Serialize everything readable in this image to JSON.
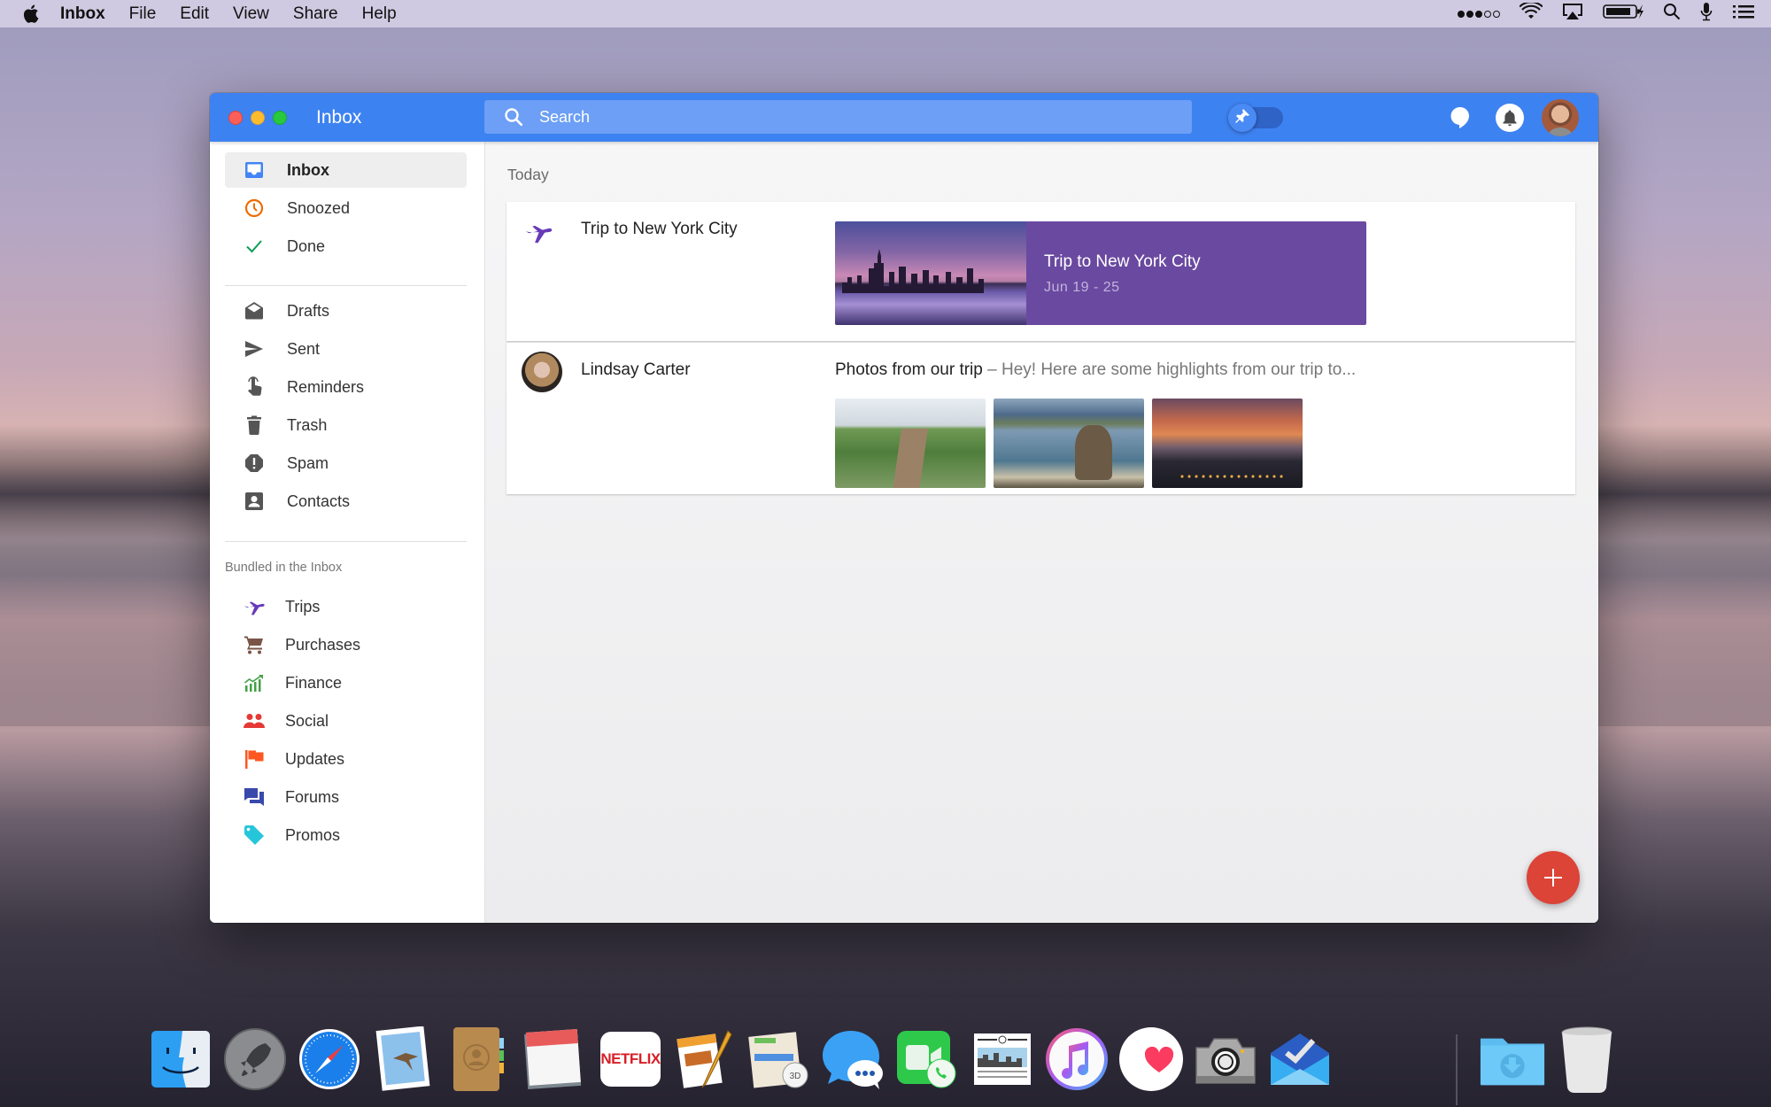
{
  "menubar": {
    "app_name": "Inbox",
    "menus": [
      "File",
      "Edit",
      "View",
      "Share",
      "Help"
    ],
    "status_icons": [
      "signal-strength-icon",
      "wifi-icon",
      "airplay-icon",
      "battery-charging-icon",
      "spotlight-search-icon",
      "siri-icon",
      "notification-center-icon"
    ],
    "signal_bars_on": 3,
    "signal_bars_total": 5
  },
  "window": {
    "title": "Inbox",
    "search": {
      "placeholder": "Search",
      "value": ""
    },
    "pin_toggle": {
      "label": "Pinned filter",
      "on": false
    },
    "accent_color": "#3d82f1"
  },
  "sidebar": {
    "primary": [
      {
        "label": "Inbox",
        "icon": "inbox-icon",
        "active": true,
        "color": "#4285f4"
      },
      {
        "label": "Snoozed",
        "icon": "clock-icon",
        "color": "#ef6c00"
      },
      {
        "label": "Done",
        "icon": "check-icon",
        "color": "#0f9d58"
      }
    ],
    "secondary": [
      {
        "label": "Drafts",
        "icon": "drafts-icon"
      },
      {
        "label": "Sent",
        "icon": "send-icon"
      },
      {
        "label": "Reminders",
        "icon": "reminder-hand-icon"
      },
      {
        "label": "Trash",
        "icon": "trash-icon"
      },
      {
        "label": "Spam",
        "icon": "spam-icon"
      },
      {
        "label": "Contacts",
        "icon": "contacts-icon"
      }
    ],
    "bundles_label": "Bundled in the Inbox",
    "bundles": [
      {
        "label": "Trips",
        "icon": "plane-icon",
        "color": "#673ab7"
      },
      {
        "label": "Purchases",
        "icon": "cart-icon",
        "color": "#795548"
      },
      {
        "label": "Finance",
        "icon": "finance-chart-icon",
        "color": "#43a047"
      },
      {
        "label": "Social",
        "icon": "people-icon",
        "color": "#e53935"
      },
      {
        "label": "Updates",
        "icon": "flag-icon",
        "color": "#ff5722"
      },
      {
        "label": "Forums",
        "icon": "forum-icon",
        "color": "#3949ab"
      },
      {
        "label": "Promos",
        "icon": "tag-icon",
        "color": "#26c6da"
      }
    ]
  },
  "content": {
    "section_label": "Today",
    "trip": {
      "title": "Trip to New York City",
      "card_title": "Trip to New York City",
      "card_dates": "Jun 19 - 25",
      "card_color": "#6a49a0"
    },
    "email": {
      "sender": "Lindsay Carter",
      "subject": "Photos from our trip",
      "separator": " – ",
      "snippet": "Hey! Here are some highlights from our trip to...",
      "attachments": [
        "Coastal trail photo",
        "Beach rock photo",
        "City sunset photo"
      ]
    },
    "compose_button": "Compose"
  },
  "dock": {
    "apps": [
      "Finder",
      "Launchpad",
      "Safari",
      "Mail",
      "Contacts",
      "Calendar",
      "Netflix",
      "Pages",
      "Maps",
      "Messages",
      "FaceTime",
      "News",
      "iTunes",
      "Health",
      "Screenshot",
      "Inbox",
      "Downloads",
      "Trash"
    ],
    "netflix_label": "NETFLIX"
  }
}
